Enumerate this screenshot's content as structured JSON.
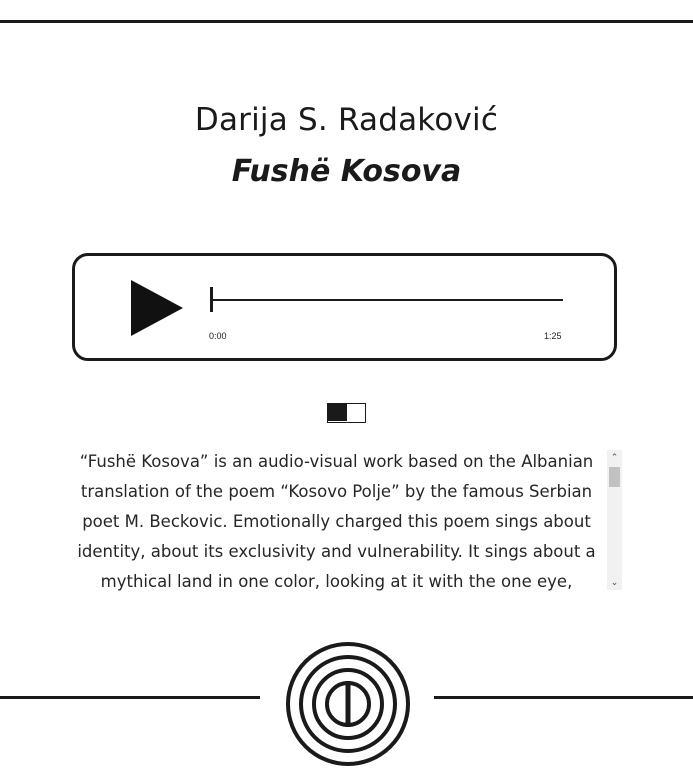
{
  "header": {
    "author": "Darija S. Radaković",
    "work_title": "Fushë Kosova"
  },
  "player": {
    "play_icon": "play-icon",
    "progress": 0,
    "current_time": "0:00",
    "total_time": "1:25"
  },
  "toggle": {
    "state": "left"
  },
  "description": {
    "text": "“Fushë Kosova” is an audio-visual work based on the Albanian translation of the poem “Kosovo Polje” by the famous Serbian poet M. Beckovic. Emotionally charged this poem sings about identity, about its exclusivity and vulnerability. It sings about a mythical land in one color, looking at it with the one eye,"
  },
  "scrollbar": {
    "up_icon": "scroll-up-arrow-icon",
    "down_icon": "scroll-down-arrow-icon",
    "up_glyph": "⌃",
    "down_glyph": "⌄"
  },
  "footer": {
    "logo_icon": "concentric-circles-logo-icon"
  },
  "colors": {
    "ink": "#1a1a1a",
    "background": "#ffffff",
    "scroll_track": "#f1f1f1",
    "scroll_thumb": "#c1c1c1"
  }
}
